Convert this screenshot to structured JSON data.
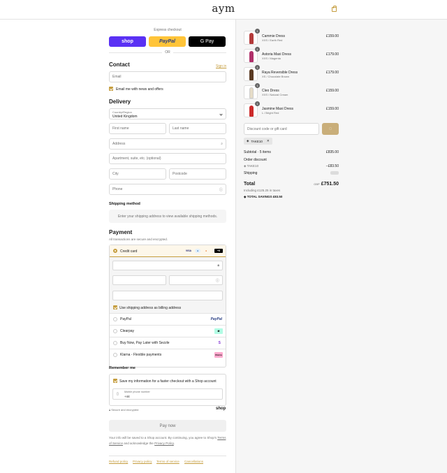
{
  "header": {
    "logo": "aym",
    "cart_icon": "bag-icon",
    "accent": "#c59d3f"
  },
  "express": {
    "label": "Express checkout",
    "shop": "shop",
    "paypal": "PayPal",
    "gpay": "G Pay",
    "or": "OR"
  },
  "contact": {
    "title": "Contact",
    "sign_in": "Sign in",
    "email_placeholder": "Email",
    "news_label": "Email me with news and offers"
  },
  "delivery": {
    "title": "Delivery",
    "country_label": "Country/Region",
    "country_value": "United Kingdom",
    "first_name": "First name",
    "last_name": "Last name",
    "address": "Address",
    "apartment": "Apartment, suite, etc. (optional)",
    "city": "City",
    "postcode": "Postcode",
    "phone": "Phone"
  },
  "shipping": {
    "title": "Shipping method",
    "message": "Enter your shipping address to view available shipping methods."
  },
  "payment": {
    "title": "Payment",
    "subtitle": "All transactions are secure and encrypted.",
    "credit_card": "Credit card",
    "card_brands": [
      "VISA",
      "MAE",
      "MC",
      "+5"
    ],
    "billing_label": "Use shipping address as billing address",
    "options": [
      {
        "label": "PayPal",
        "badge": "PayPal"
      },
      {
        "label": "Clearpay",
        "badge": "⇄"
      },
      {
        "label": "Buy Now, Pay Later with Sezzle",
        "badge": "S"
      },
      {
        "label": "Klarna - Flexible payments",
        "badge": "Klarna"
      }
    ]
  },
  "remember": {
    "title": "Remember me",
    "save_label": "Save my information for a faster checkout with a Shop account",
    "phone_label": "Mobile phone number",
    "phone_value": "+44",
    "secure": "Secure and encrypted",
    "shop": "shop"
  },
  "pay_now": "Pay now",
  "terms": {
    "line1": "Your info will be saved to a Shop account. By continuing, you agree to Shop's",
    "tos": "Terms of Service",
    "mid": "and acknowledge the",
    "privacy": "Privacy Policy",
    "end": "."
  },
  "footer": [
    "Refund policy",
    "Privacy policy",
    "Terms of service",
    "Cancellations"
  ],
  "cart": {
    "items": [
      {
        "name": "Cammie Dress",
        "variant": "XXS / Earth Red",
        "price": "£159.00",
        "qty": "1",
        "color": "#b33a3a"
      },
      {
        "name": "Astoria Maxi Dress",
        "variant": "XXS / Magenta",
        "price": "£179.00",
        "qty": "1",
        "color": "#b0306a"
      },
      {
        "name": "Raya Reversible Dress",
        "variant": "XS / Chocolate Brown",
        "price": "£179.00",
        "qty": "1",
        "color": "#5a3a22"
      },
      {
        "name": "Cleo Dress",
        "variant": "XXS / Natural Cream",
        "price": "£159.00",
        "qty": "1",
        "color": "#e6dcc7"
      },
      {
        "name": "Jasmine Maxi Dress",
        "variant": "L / Bright Red",
        "price": "£159.00",
        "qty": "1",
        "color": "#cc2a2a"
      }
    ],
    "discount_placeholder": "Discount code or gift card",
    "applied_code": "TAKE10",
    "subtotal_label": "Subtotal · 5 items",
    "subtotal_value": "£835.00",
    "order_discount": "Order discount",
    "discount_code": "TAKE10",
    "discount_value": "−£83.50",
    "shipping_label": "Shipping",
    "total_label": "Total",
    "currency": "GBP",
    "total_value": "£751.50",
    "taxes": "Including £125.25 in taxes",
    "savings_label": "TOTAL SAVINGS",
    "savings_value": "£83.50"
  }
}
